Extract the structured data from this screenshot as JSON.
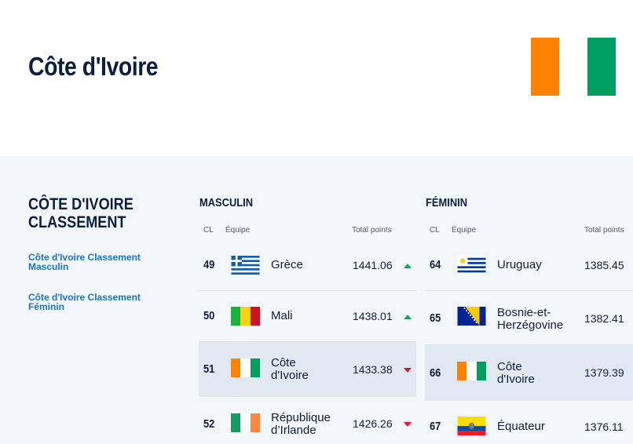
{
  "header": {
    "title": "Côte d'Ivoire",
    "flag_colors": [
      "#ff8200",
      "#ffffff",
      "#009e60"
    ]
  },
  "sidebar": {
    "title_line1": "CÔTE D'IVOIRE",
    "title_line2": "CLASSEMENT",
    "links": [
      {
        "line1": "Côte d'Ivoire Classement",
        "line2": "Masculin"
      },
      {
        "line1": "Côte d'Ivoire Classement",
        "line2": "Féminin"
      }
    ]
  },
  "tables": {
    "headers": {
      "rank": "CL",
      "team": "Équipe",
      "points": "Total points"
    },
    "men": {
      "title": "MASCULIN",
      "rows": [
        {
          "rank": "49",
          "name1": "Grèce",
          "name2": "",
          "points": "1441.06",
          "trend": "up",
          "flag": "greece-flag-icon",
          "highlight": false
        },
        {
          "rank": "50",
          "name1": "Mali",
          "name2": "",
          "points": "1438.01",
          "trend": "up",
          "flag": "mali-flag-icon",
          "highlight": false
        },
        {
          "rank": "51",
          "name1": "Côte",
          "name2": "d'Ivoire",
          "points": "1433.38",
          "trend": "down",
          "flag": "cote-divoire-flag-icon",
          "highlight": true
        },
        {
          "rank": "52",
          "name1": "République",
          "name2": "d’Irlande",
          "points": "1426.26",
          "trend": "down",
          "flag": "ireland-flag-icon",
          "highlight": false
        }
      ]
    },
    "women": {
      "title": "FÉMININ",
      "rows": [
        {
          "rank": "64",
          "name1": "Uruguay",
          "name2": "",
          "points": "1385.45",
          "flag": "uruguay-flag-icon",
          "highlight": false
        },
        {
          "rank": "65",
          "name1": "Bosnie-et-",
          "name2": "Herzégovine",
          "points": "1382.41",
          "flag": "bosnia-flag-icon",
          "highlight": false
        },
        {
          "rank": "66",
          "name1": "Côte",
          "name2": "d'Ivoire",
          "points": "1379.39",
          "flag": "cote-divoire-flag-icon",
          "highlight": true
        },
        {
          "rank": "67",
          "name1": "Équateur",
          "name2": "",
          "points": "1376.11",
          "flag": "ecuador-flag-icon",
          "highlight": false
        }
      ]
    }
  }
}
